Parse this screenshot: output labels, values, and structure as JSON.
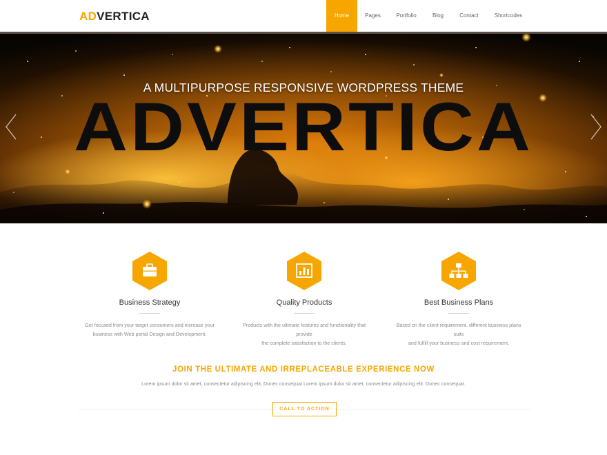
{
  "brand": {
    "logo_accent": "AD",
    "logo_rest": "VERTICA",
    "accent_color": "#f7a600"
  },
  "nav": {
    "items": [
      {
        "label": "Home",
        "active": true
      },
      {
        "label": "Pages",
        "active": false
      },
      {
        "label": "Portfolio",
        "active": false
      },
      {
        "label": "Blog",
        "active": false
      },
      {
        "label": "Contact",
        "active": false
      },
      {
        "label": "Shortcodes",
        "active": false
      }
    ]
  },
  "hero": {
    "tagline": "A MULTIPURPOSE RESPONSIVE WORDPRESS THEME",
    "title": "ADVERTICA",
    "left_arrow_icon": "chevron-left-icon",
    "right_arrow_icon": "chevron-right-icon"
  },
  "features": [
    {
      "icon": "briefcase-icon",
      "title": "Business Strategy",
      "desc_line1": "Get focused from your target consumers and increase your",
      "desc_line2": "business with Web portal Design and Development."
    },
    {
      "icon": "bar-chart-icon",
      "title": "Quality Products",
      "desc_line1": "Products with the ultimate features and functionality that provide",
      "desc_line2": "the complete satisfaction to the clients."
    },
    {
      "icon": "sitemap-icon",
      "title": "Best Business Plans",
      "desc_line1": "Based on the client requirement, different business plans suits",
      "desc_line2": "and fulfill your business and cost requirement."
    }
  ],
  "cta": {
    "heading": "JOIN THE ULTIMATE AND IRREPLACEABLE EXPERIENCE NOW",
    "text": "Lorem ipsum dolor sit amet, consectetur adipiscing elit. Donec consequat Lorem ipsum dolor sit amet, consectetur adipiscing elit. Donec consequat.",
    "button_label": "CALL TO ACTION"
  }
}
